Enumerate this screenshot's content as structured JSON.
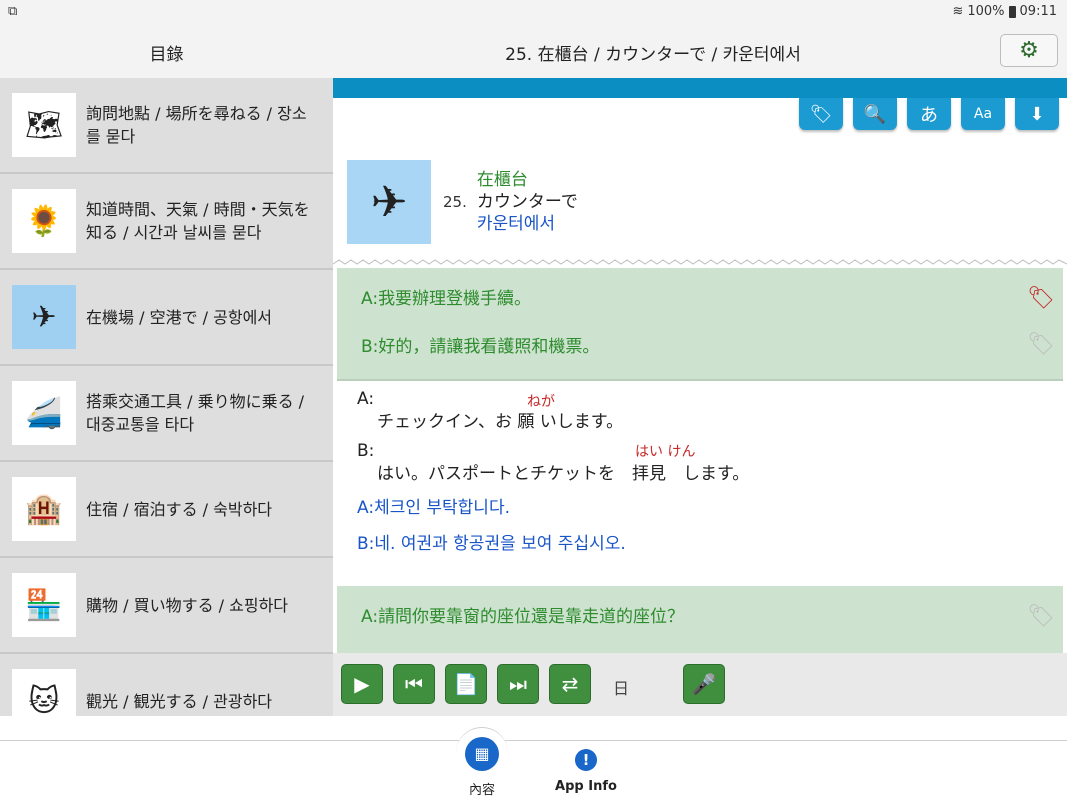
{
  "status": {
    "left_icon": "notification-icon",
    "battery": "100%",
    "time": "09:11"
  },
  "header": {
    "left_title": "目錄",
    "main_title": "25. 在櫃台 / カウンターで / 카운터에서"
  },
  "sidebar": {
    "items": [
      {
        "label": "詢問地點 / 場所を尋ねる / 장소를 묻다",
        "icon": "map-board-icon"
      },
      {
        "label": "知道時間、天氣 / 時間・天気を知る / 시간과 날씨를 묻다",
        "icon": "sun-flower-icon"
      },
      {
        "label": "在機場 / 空港で / 공항에서",
        "icon": "airplane-icon"
      },
      {
        "label": "搭乘交通工具 / 乗り物に乗る / 대중교통을 타다",
        "icon": "train-taxi-icon"
      },
      {
        "label": "住宿 / 宿泊する / 숙박하다",
        "icon": "hotel-icon"
      },
      {
        "label": "購物 / 買い物する / 쇼핑하다",
        "icon": "shop-icon"
      },
      {
        "label": "觀光 / 観光する / 관광하다",
        "icon": "sightseeing-icon"
      }
    ]
  },
  "toolbar": {
    "font_char": "あ",
    "size_char": "Aa"
  },
  "lesson": {
    "number": "25.",
    "zh": "在櫃台",
    "ja": "カウンターで",
    "ko": "카운터에서"
  },
  "dialog1": {
    "zh": [
      {
        "speaker": "A:",
        "text": "我要辦理登機手續。"
      },
      {
        "speaker": "B:",
        "text": "好的，請讓我看護照和機票。"
      }
    ],
    "ja": [
      {
        "speaker": "A:",
        "text": "チェックイン、お 願 いします。",
        "ruby": "ねが"
      },
      {
        "speaker": "B:",
        "text": "はい。パスポートとチケットを　拝見　します。",
        "ruby": "はい けん"
      }
    ],
    "ko": [
      {
        "speaker": "A:",
        "text": "체크인 부탁합니다."
      },
      {
        "speaker": "B:",
        "text": "네. 여권과 항공권을 보여 주십시오."
      }
    ]
  },
  "dialog2": {
    "zh": [
      {
        "speaker": "A:",
        "text": "請問你要靠窗的座位還是靠走道的座位？"
      }
    ]
  },
  "playbar": {
    "lang_label": "日"
  },
  "bottomnav": {
    "contents_label": "內容",
    "info_label": "App Info"
  },
  "colors": {
    "accent": "#0b8fc3",
    "green": "#3f8f3f",
    "nav_blue": "#1967c9"
  }
}
